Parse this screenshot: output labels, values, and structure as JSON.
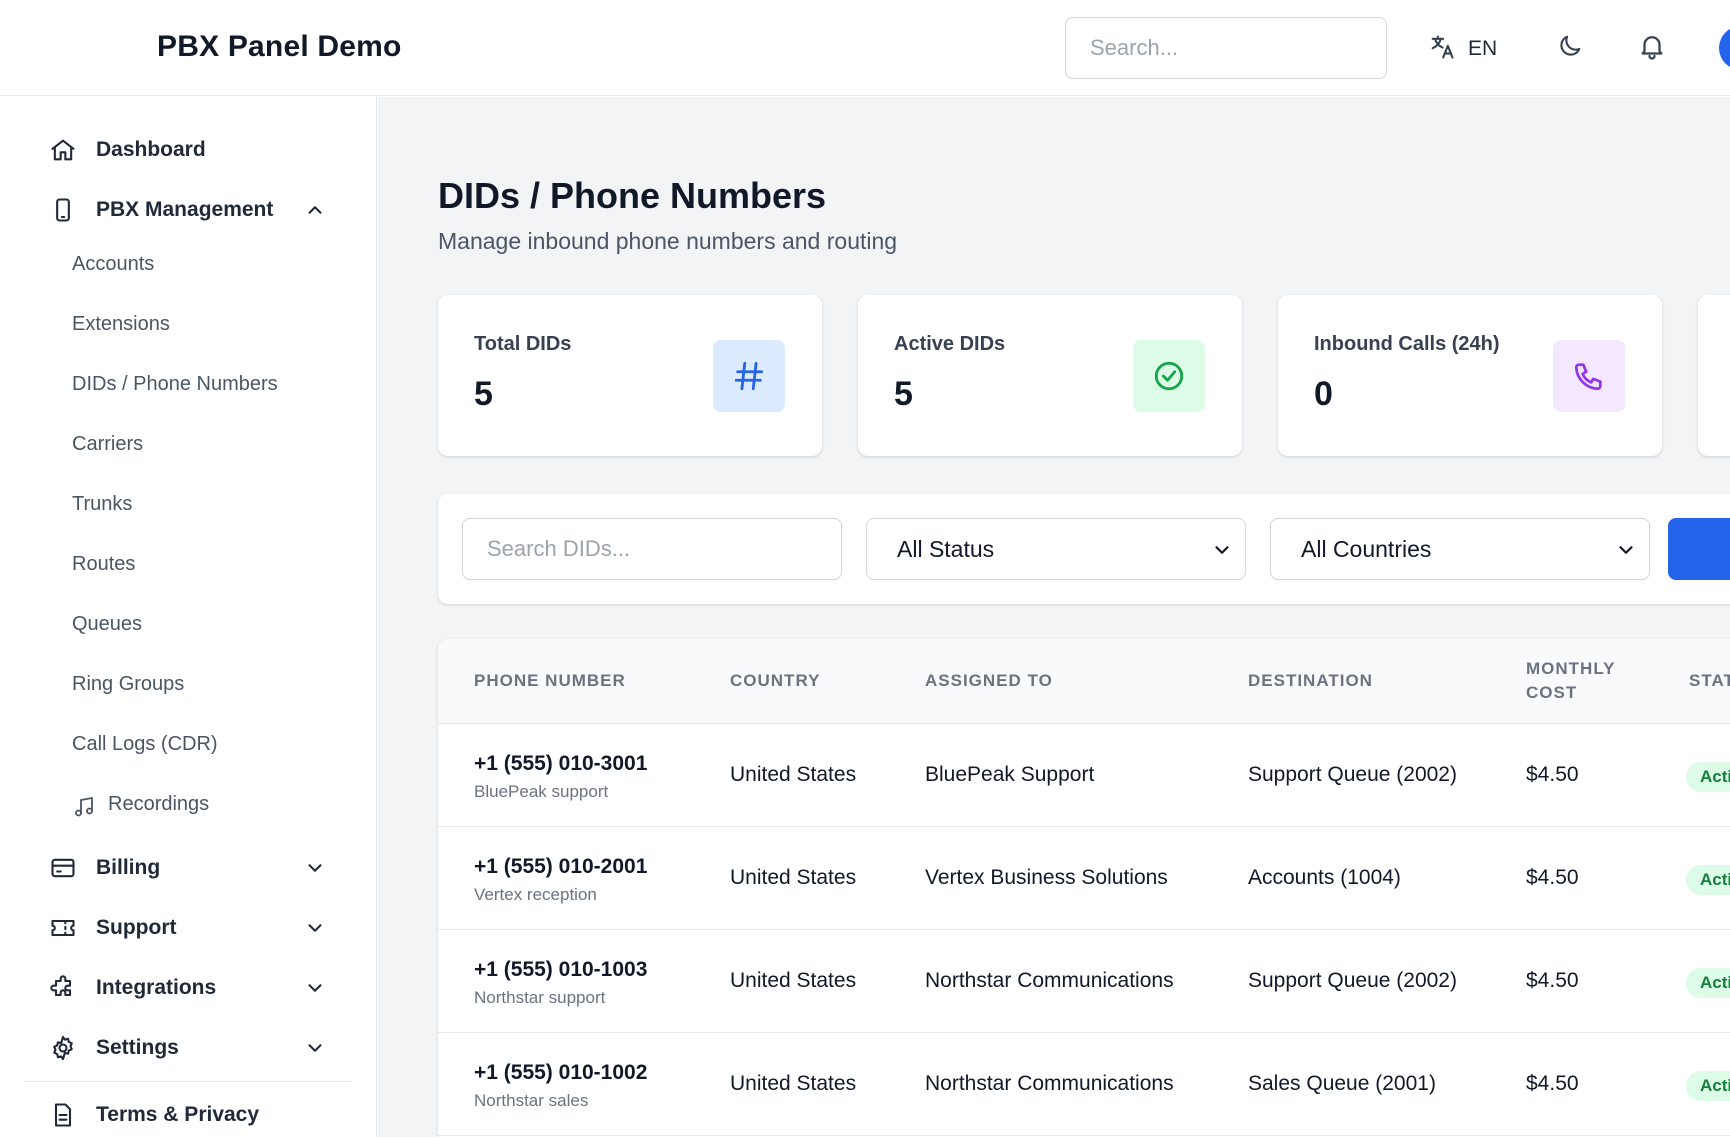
{
  "header": {
    "brand": "PBX Panel Demo",
    "search_placeholder": "Search...",
    "language": "EN",
    "icons": [
      "translate-icon",
      "moon-icon",
      "bell-icon"
    ]
  },
  "sidebar": {
    "dashboard": "Dashboard",
    "pbx_management": "PBX Management",
    "sub_items": [
      "Accounts",
      "Extensions",
      "DIDs / Phone Numbers",
      "Carriers",
      "Trunks",
      "Routes",
      "Queues",
      "Ring Groups",
      "Call Logs (CDR)",
      "Recordings"
    ],
    "billing": "Billing",
    "support": "Support",
    "integrations": "Integrations",
    "settings": "Settings",
    "terms": "Terms & Privacy"
  },
  "main": {
    "title": "DIDs / Phone Numbers",
    "subtitle": "Manage inbound phone numbers and routing",
    "stats": [
      {
        "label": "Total DIDs",
        "value": "5",
        "icon": "hash-icon",
        "bg": "#dbeafe",
        "fg": "#2563eb"
      },
      {
        "label": "Active DIDs",
        "value": "5",
        "icon": "check-circle-icon",
        "bg": "#dcfce7",
        "fg": "#16a34a"
      },
      {
        "label": "Inbound Calls (24h)",
        "value": "0",
        "icon": "phone-icon",
        "bg": "#f3e8ff",
        "fg": "#9333ea"
      }
    ],
    "filters": {
      "search_placeholder": "Search DIDs...",
      "status": "All Status",
      "country": "All Countries"
    },
    "table": {
      "columns": [
        "PHONE NUMBER",
        "COUNTRY",
        "ASSIGNED TO",
        "DESTINATION",
        "MONTHLY COST",
        "STAT"
      ],
      "rows": [
        {
          "number": "+1 (555) 010-3001",
          "note": "BluePeak support",
          "country": "United States",
          "assigned": "BluePeak Support",
          "destination": "Support Queue (2002)",
          "cost": "$4.50",
          "status": "Acti"
        },
        {
          "number": "+1 (555) 010-2001",
          "note": "Vertex reception",
          "country": "United States",
          "assigned": "Vertex Business Solutions",
          "destination": "Accounts (1004)",
          "cost": "$4.50",
          "status": "Acti"
        },
        {
          "number": "+1 (555) 010-1003",
          "note": "Northstar support",
          "country": "United States",
          "assigned": "Northstar Communications",
          "destination": "Support Queue (2002)",
          "cost": "$4.50",
          "status": "Acti"
        },
        {
          "number": "+1 (555) 010-1002",
          "note": "Northstar sales",
          "country": "United States",
          "assigned": "Northstar Communications",
          "destination": "Sales Queue (2001)",
          "cost": "$4.50",
          "status": "Acti"
        }
      ]
    }
  },
  "colors": {
    "accent": "#2563eb",
    "badge_bg": "#dcfce7",
    "badge_text": "#15803d"
  }
}
